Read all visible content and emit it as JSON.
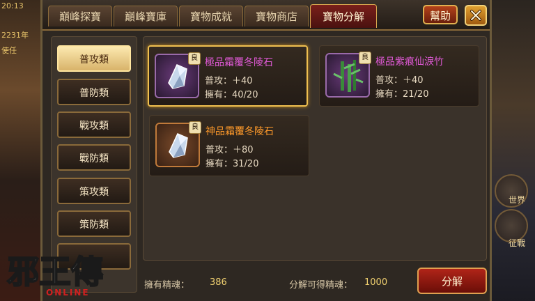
{
  "background": {
    "left_texts": [
      "20:13",
      "2231年",
      "使任"
    ],
    "right_labels": [
      "世界",
      "征戰"
    ]
  },
  "tabs": [
    {
      "label": "巔峰探寶",
      "active": false
    },
    {
      "label": "巔峰寶庫",
      "active": false
    },
    {
      "label": "寶物成就",
      "active": false
    },
    {
      "label": "寶物商店",
      "active": false
    },
    {
      "label": "寶物分解",
      "active": true
    }
  ],
  "header": {
    "help_label": "幫助",
    "close_icon": "close-icon"
  },
  "categories": [
    {
      "label": "普攻類",
      "active": true
    },
    {
      "label": "普防類",
      "active": false
    },
    {
      "label": "戰攻類",
      "active": false
    },
    {
      "label": "戰防類",
      "active": false
    },
    {
      "label": "策攻類",
      "active": false
    },
    {
      "label": "策防類",
      "active": false
    },
    {
      "label": "",
      "active": false
    }
  ],
  "items": [
    {
      "name": "極品霜覆冬陵石",
      "grade": "良",
      "stat": "普攻：＋40",
      "own": "擁有：40/20",
      "rarity": "purple",
      "icon": "crystal-icon",
      "selected": true
    },
    {
      "name": "極品紫痕仙淚竹",
      "grade": "良",
      "stat": "普攻：＋40",
      "own": "擁有：21/20",
      "rarity": "purple",
      "icon": "bamboo-icon",
      "selected": false
    },
    {
      "name": "神品霜覆冬陵石",
      "grade": "良",
      "stat": "普攻：＋80",
      "own": "擁有：31/20",
      "rarity": "orange",
      "icon": "crystal-icon",
      "selected": false
    }
  ],
  "footer": {
    "own_essence_label": "擁有精魂：",
    "own_essence_value": "386",
    "gain_essence_label": "分解可得精魂：",
    "gain_essence_value": "1000",
    "decompose_label": "分解"
  },
  "logo": {
    "title": "邪王傳",
    "subtitle": "ONLINE"
  },
  "colors": {
    "accent_gold": "#f0c050",
    "purple_name": "#e25ad8",
    "orange_name": "#ff9a2a",
    "value_yellow": "#f0d070"
  }
}
